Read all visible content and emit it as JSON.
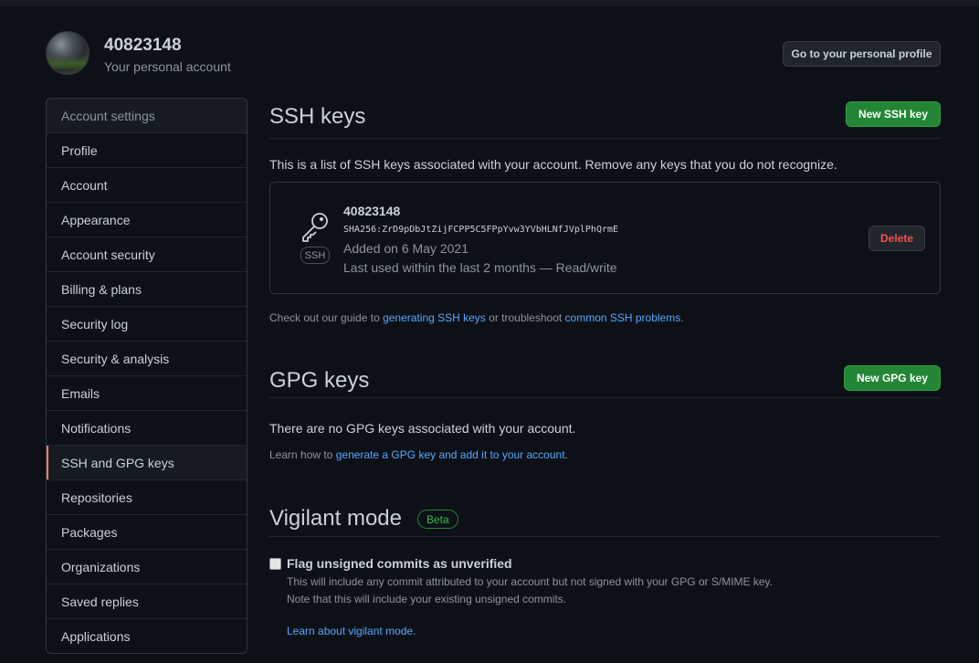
{
  "account": {
    "name": "40823148",
    "subtitle": "Your personal account",
    "profile_button": "Go to your personal profile"
  },
  "sidebar": {
    "heading": "Account settings",
    "items": [
      {
        "label": "Profile"
      },
      {
        "label": "Account"
      },
      {
        "label": "Appearance"
      },
      {
        "label": "Account security"
      },
      {
        "label": "Billing & plans"
      },
      {
        "label": "Security log"
      },
      {
        "label": "Security & analysis"
      },
      {
        "label": "Emails"
      },
      {
        "label": "Notifications"
      },
      {
        "label": "SSH and GPG keys",
        "active": true
      },
      {
        "label": "Repositories"
      },
      {
        "label": "Packages"
      },
      {
        "label": "Organizations"
      },
      {
        "label": "Saved replies"
      },
      {
        "label": "Applications"
      }
    ]
  },
  "ssh": {
    "title": "SSH keys",
    "new_button": "New SSH key",
    "description": "This is a list of SSH keys associated with your account. Remove any keys that you do not recognize.",
    "key": {
      "title": "40823148",
      "fingerprint": "SHA256:ZrD9pDbJtZijFCPP5C5FPpYvw3YVbHLNfJVplPhQrmE",
      "added": "Added on 6 May 2021",
      "last_used": "Last used within the last 2 months — Read/write",
      "badge": "SSH",
      "delete_button": "Delete",
      "icon": "key-icon"
    },
    "guide_prefix": "Check out our guide to ",
    "guide_link": "generating SSH keys",
    "guide_middle": " or troubleshoot ",
    "guide_link2": "common SSH problems",
    "guide_suffix": "."
  },
  "gpg": {
    "title": "GPG keys",
    "new_button": "New GPG key",
    "empty_text": "There are no GPG keys associated with your account.",
    "learn_prefix": "Learn how to ",
    "learn_link": "generate a GPG key and add it to your account",
    "learn_suffix": "."
  },
  "vigilant": {
    "title": "Vigilant mode",
    "badge": "Beta",
    "checkbox_label": "Flag unsigned commits as unverified",
    "checked": false,
    "note1": "This will include any commit attributed to your account but not signed with your GPG or S/MIME key.",
    "note2": "Note that this will include your existing unsigned commits.",
    "learn_link": "Learn about vigilant mode."
  },
  "colors": {
    "background": "#0d1117",
    "accent_green": "#238636",
    "link": "#58a6ff",
    "danger": "#f85149",
    "active_marker": "#f78166"
  }
}
